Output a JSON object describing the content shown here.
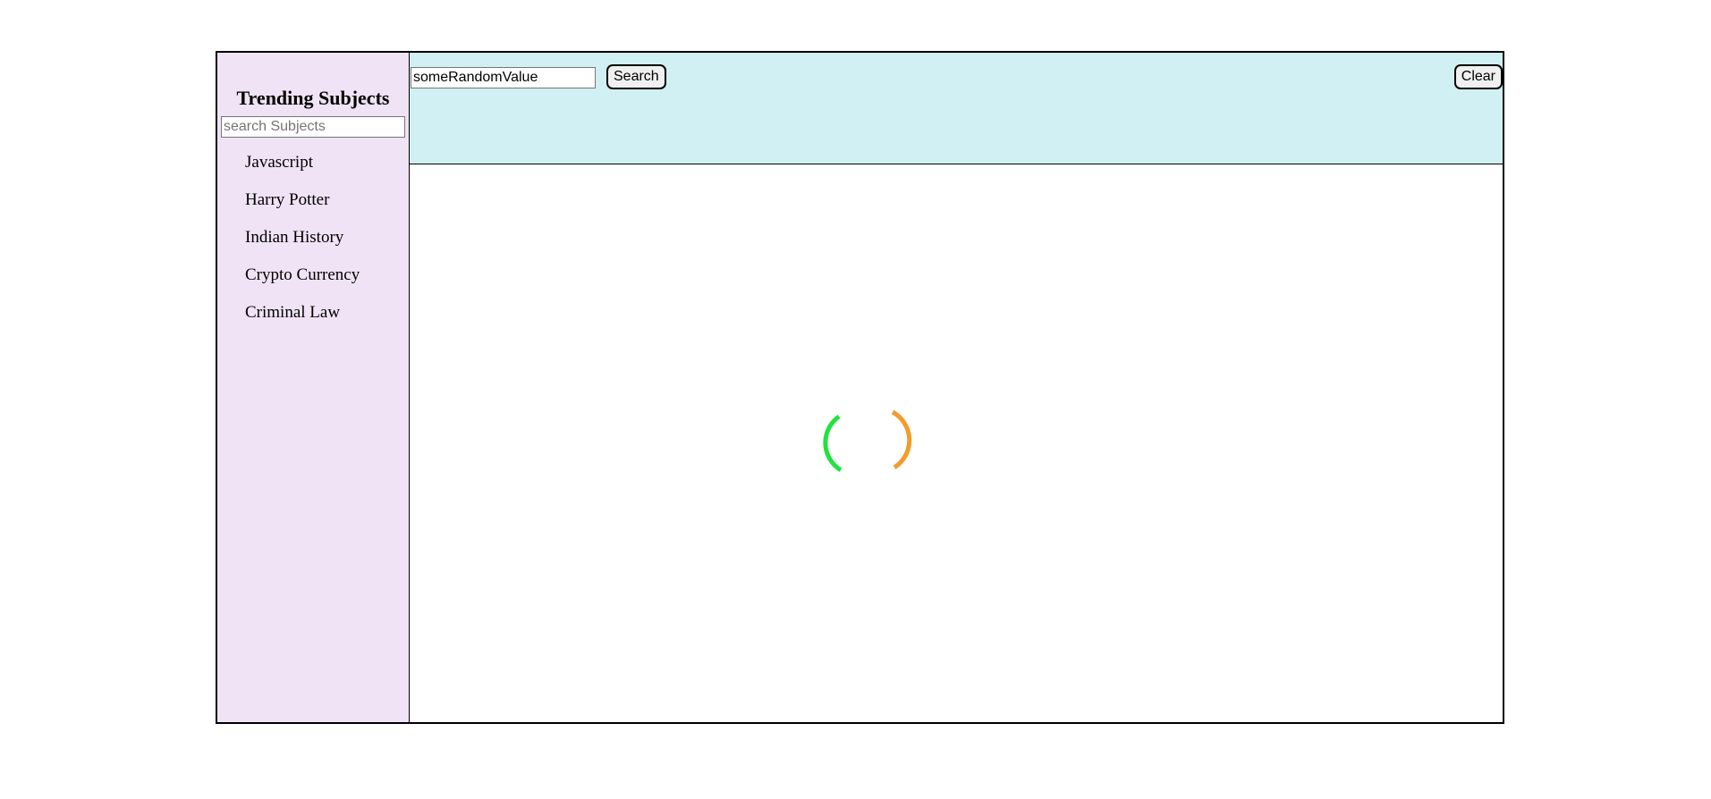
{
  "sidebar": {
    "title": "Trending Subjects",
    "search_placeholder": "search Subjects",
    "items": [
      {
        "label": "Javascript"
      },
      {
        "label": "Harry Potter"
      },
      {
        "label": "Indian History"
      },
      {
        "label": "Crypto Currency"
      },
      {
        "label": "Criminal Law"
      }
    ]
  },
  "topbar": {
    "search_value": "someRandomValue",
    "search_label": "Search",
    "clear_label": "Clear"
  },
  "loader": {
    "icon": "loading-spinner-icon",
    "colors": [
      "#22e23f",
      "#f39c2b"
    ]
  },
  "colors": {
    "sidebar_bg": "#f0e3f5",
    "topbar_bg": "#d0f0f3"
  }
}
